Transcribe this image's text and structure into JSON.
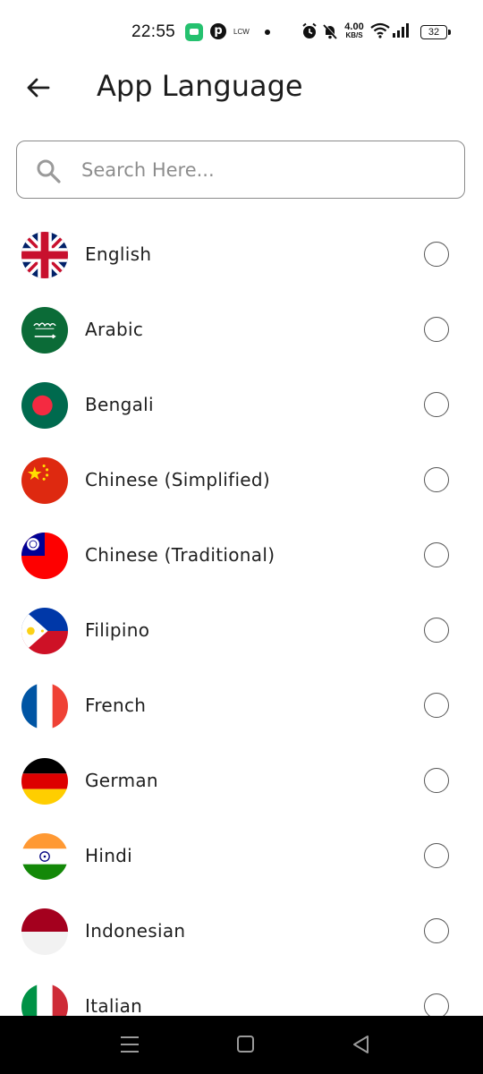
{
  "status_bar": {
    "time": "22:55",
    "lcw_label": "LCW",
    "net_speed_value": "4.00",
    "net_speed_unit": "KB/S",
    "battery": "32"
  },
  "header": {
    "title": "App Language",
    "back_icon": "arrow-left-icon"
  },
  "search": {
    "placeholder": "Search Here...",
    "value": ""
  },
  "languages": [
    {
      "label": "English",
      "flag": "uk-flag",
      "selected": false
    },
    {
      "label": "Arabic",
      "flag": "saudi-flag",
      "selected": false
    },
    {
      "label": "Bengali",
      "flag": "bangladesh-flag",
      "selected": false
    },
    {
      "label": "Chinese (Simplified)",
      "flag": "china-flag",
      "selected": false
    },
    {
      "label": "Chinese (Traditional)",
      "flag": "taiwan-flag",
      "selected": false
    },
    {
      "label": "Filipino",
      "flag": "philippines-flag",
      "selected": false
    },
    {
      "label": "French",
      "flag": "france-flag",
      "selected": false
    },
    {
      "label": "German",
      "flag": "germany-flag",
      "selected": false
    },
    {
      "label": "Hindi",
      "flag": "india-flag",
      "selected": false
    },
    {
      "label": "Indonesian",
      "flag": "indonesia-flag",
      "selected": false
    },
    {
      "label": "Italian",
      "flag": "italy-flag",
      "selected": false
    }
  ],
  "nav_bar": {
    "buttons": [
      "menu-icon",
      "home-square-icon",
      "back-triangle-icon"
    ]
  }
}
